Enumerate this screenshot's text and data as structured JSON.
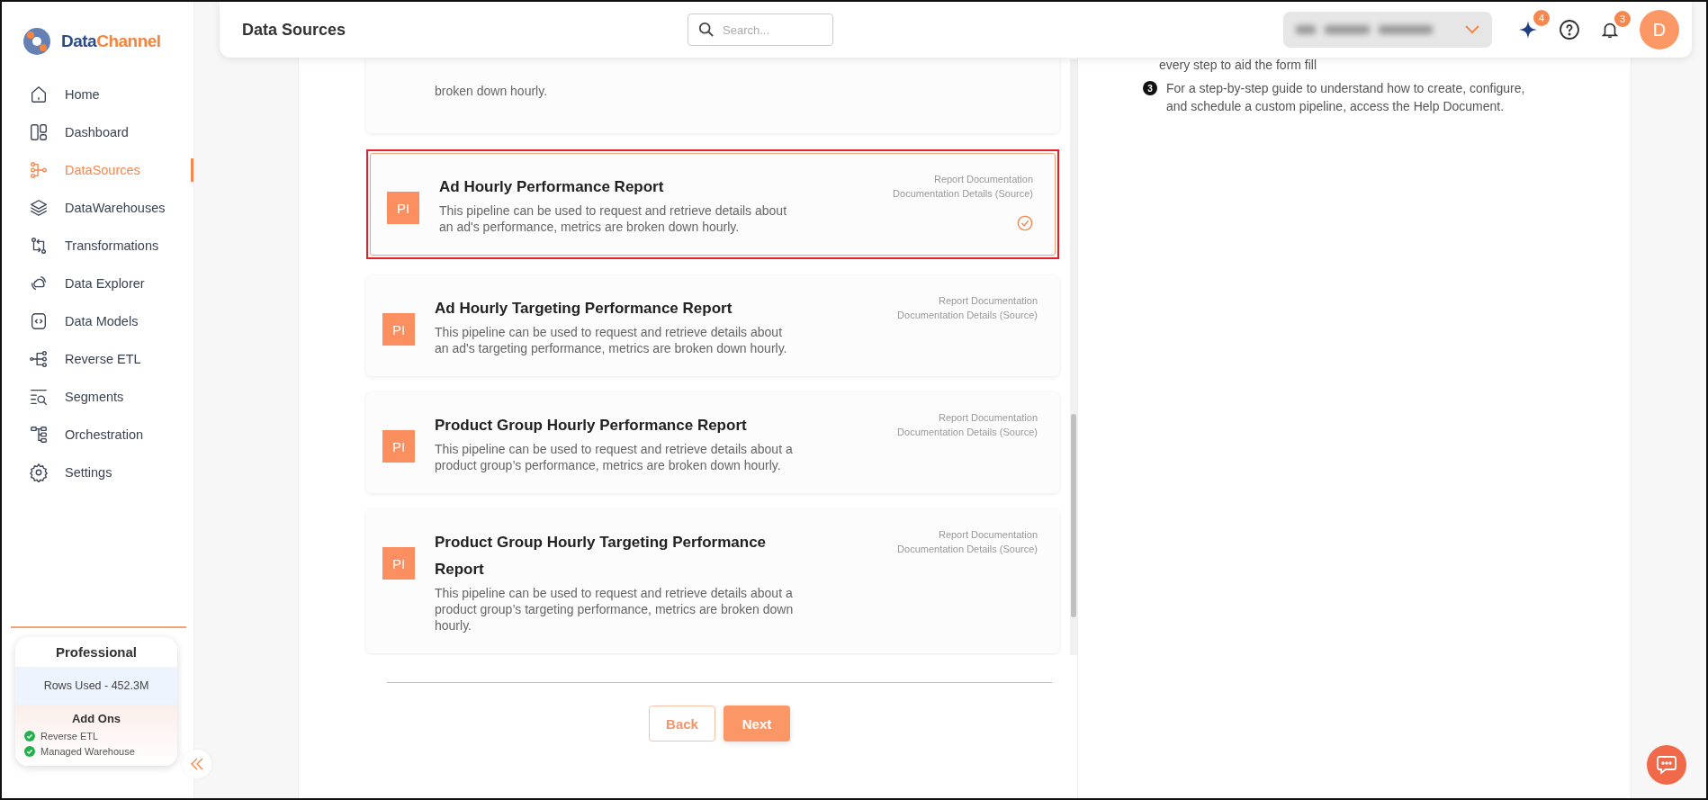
{
  "sidebar": {
    "logo": {
      "first": "Data",
      "second": "Channel"
    },
    "items": [
      {
        "label": "Home",
        "selected": false
      },
      {
        "label": "Dashboard",
        "selected": false
      },
      {
        "label": "DataSources",
        "selected": true
      },
      {
        "label": "DataWarehouses",
        "selected": false
      },
      {
        "label": "Transformations",
        "selected": false
      },
      {
        "label": "Data Explorer",
        "selected": false
      },
      {
        "label": "Data Models",
        "selected": false
      },
      {
        "label": "Reverse ETL",
        "selected": false
      },
      {
        "label": "Segments",
        "selected": false
      },
      {
        "label": "Orchestration",
        "selected": false
      },
      {
        "label": "Settings",
        "selected": false
      }
    ],
    "plan": {
      "name": "Professional",
      "rows_used": "Rows Used - 452.3M",
      "addons_title": "Add Ons",
      "addons": [
        "Reverse ETL",
        "Managed Warehouse"
      ]
    }
  },
  "header": {
    "title": "Data Sources",
    "search": {
      "placeholder": "Search..."
    },
    "actions": [
      {
        "kind": "sparkle",
        "count": "4"
      },
      {
        "kind": "help"
      },
      {
        "kind": "bell",
        "count": "3"
      }
    ],
    "avatar": "D"
  },
  "reports": {
    "partial_text": "broken down hourly.",
    "items": [
      {
        "badge": "PI",
        "title": "Ad Hourly Performance Report",
        "description": "This pipeline can be used to request and retrieve details about an ad's performance, metrics are broken down hourly.",
        "links": [
          "Report Documentation",
          "Documentation Details (Source)"
        ],
        "selected": true
      },
      {
        "badge": "PI",
        "title": "Ad Hourly Targeting Performance Report",
        "description": "This pipeline can be used to request and retrieve details about an ad's targeting performance, metrics are broken down hourly.",
        "links": [
          "Report Documentation",
          "Documentation Details (Source)"
        ],
        "selected": false
      },
      {
        "badge": "PI",
        "title": "Product Group Hourly Performance Report",
        "description": "This pipeline can be used to request and retrieve details about a product group’s performance, metrics are broken down hourly.",
        "links": [
          "Report Documentation",
          "Documentation Details (Source)"
        ],
        "selected": false
      },
      {
        "badge": "PI",
        "title": "Product Group Hourly Targeting Performance Report",
        "description": "This pipeline can be used to request and retrieve details about a product group’s targeting performance, metrics are broken down hourly.",
        "links": [
          "Report Documentation",
          "Documentation Details (Source)"
        ],
        "selected": false
      }
    ]
  },
  "buttons": [
    {
      "label": "Back",
      "kind": "secondary"
    },
    {
      "label": "Next",
      "kind": "primary"
    }
  ],
  "help": {
    "partial_text": "every step to aid the form fill",
    "steps": [
      {
        "number": "3",
        "text": "For a step-by-step guide to understand how to create, configure, and schedule a custom pipeline, access the Help Document."
      }
    ]
  }
}
